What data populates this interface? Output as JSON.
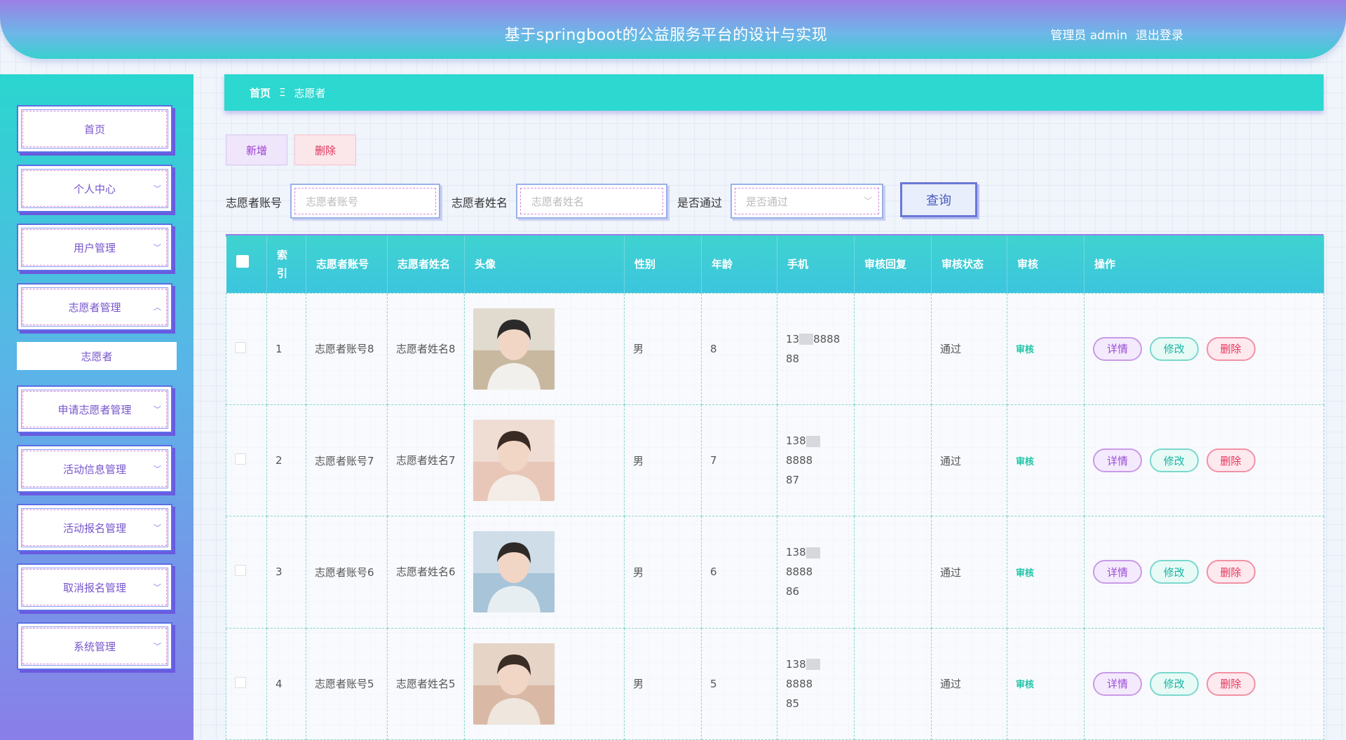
{
  "header": {
    "title": "基于springboot的公益服务平台的设计与实现",
    "user": "管理员 admin",
    "logout": "退出登录"
  },
  "sidebar": {
    "items": [
      {
        "label": "首页"
      },
      {
        "label": "个人中心"
      },
      {
        "label": "用户管理"
      },
      {
        "label": "志愿者管理"
      },
      {
        "label": "志愿者"
      },
      {
        "label": "申请志愿者管理"
      },
      {
        "label": "活动信息管理"
      },
      {
        "label": "活动报名管理"
      },
      {
        "label": "取消报名管理"
      },
      {
        "label": "系统管理"
      }
    ]
  },
  "breadcrumb": {
    "home": "首页",
    "separator": "Ξ",
    "current": "志愿者"
  },
  "toolbar": {
    "add_label": "新增",
    "delete_label": "删除"
  },
  "search": {
    "account_label": "志愿者账号",
    "account_placeholder": "志愿者账号",
    "name_label": "志愿者姓名",
    "name_placeholder": "志愿者姓名",
    "pass_label": "是否通过",
    "pass_placeholder": "是否通过",
    "query_label": "查询"
  },
  "table": {
    "headers": {
      "index": "索引",
      "account": "志愿者账号",
      "name": "志愿者姓名",
      "avatar": "头像",
      "gender": "性别",
      "age": "年龄",
      "phone": "手机",
      "reply": "审核回复",
      "status": "审核状态",
      "audit": "审核",
      "ops": "操作"
    },
    "rows": [
      {
        "index": "1",
        "account": "志愿者账号8",
        "name": "志愿者姓名8",
        "gender": "男",
        "age": "8",
        "phone_a": "13",
        "phone_b": "8888",
        "phone_c": "88",
        "status": "通过",
        "audit": "审核"
      },
      {
        "index": "2",
        "account": "志愿者账号7",
        "name": "志愿者姓名7",
        "gender": "男",
        "age": "7",
        "phone_a": "138",
        "phone_b": "8888",
        "phone_c": "87",
        "status": "通过",
        "audit": "审核"
      },
      {
        "index": "3",
        "account": "志愿者账号6",
        "name": "志愿者姓名6",
        "gender": "男",
        "age": "6",
        "phone_a": "138",
        "phone_b": "8888",
        "phone_c": "86",
        "status": "通过",
        "audit": "审核"
      },
      {
        "index": "4",
        "account": "志愿者账号5",
        "name": "志愿者姓名5",
        "gender": "男",
        "age": "5",
        "phone_a": "138",
        "phone_b": "8888",
        "phone_c": "85",
        "status": "通过",
        "audit": "审核"
      }
    ],
    "ops": {
      "detail": "详情",
      "edit": "修改",
      "delete": "删除"
    }
  },
  "colors": {
    "accent": "#2cd8cf",
    "header_top": "#9b7fe6",
    "delete": "#e8325a",
    "detail": "#9b4bd6",
    "edit": "#19b4a4"
  }
}
